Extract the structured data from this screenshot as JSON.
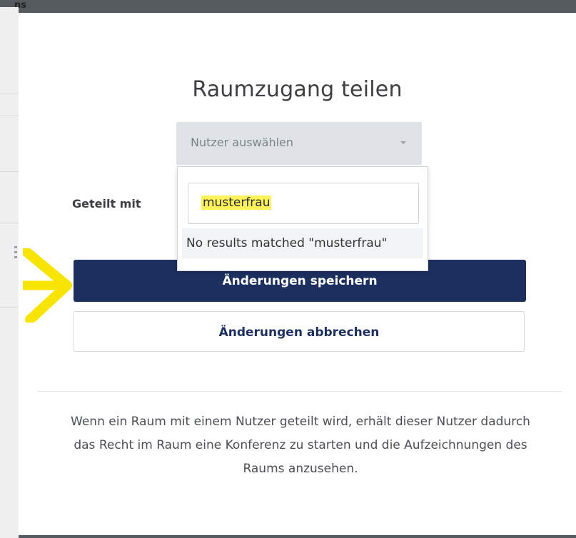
{
  "backdrop": {
    "corner_text": "ns"
  },
  "dialog": {
    "title": "Raumzugang teilen",
    "user_select": {
      "placeholder": "Nutzer auswählen"
    },
    "search": {
      "value": "musterfrau"
    },
    "no_results": "No results matched \"musterfrau\"",
    "shared_with_label": "Geteilt mit",
    "save_label": "Änderungen speichern",
    "cancel_label": "Änderungen abbrechen",
    "info_text": "Wenn ein Raum mit einem Nutzer geteilt wird, erhält dieser Nutzer dadurch das Recht im Raum eine Konferenz zu starten und die Aufzeichnungen des Raums anzusehen."
  },
  "colors": {
    "primary": "#1d2f5e",
    "highlight": "#fff25a",
    "arrow": "#f7e500"
  },
  "annotation": {
    "icon": "arrow-right-icon"
  }
}
